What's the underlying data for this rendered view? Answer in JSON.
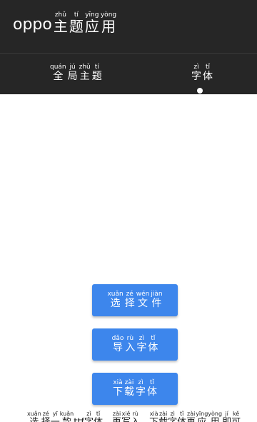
{
  "header": {
    "app_name": "oppo",
    "title": [
      {
        "char": "主",
        "pinyin": "zhǔ"
      },
      {
        "char": "题",
        "pinyin": "tí"
      },
      {
        "char": "应",
        "pinyin": "yīng"
      },
      {
        "char": "用",
        "pinyin": "yòng"
      }
    ]
  },
  "tabs": [
    {
      "id": "global-theme",
      "selected": false,
      "chars": [
        {
          "char": "全",
          "pinyin": "quán"
        },
        {
          "char": "局",
          "pinyin": "jú"
        },
        {
          "char": "主",
          "pinyin": "zhǔ"
        },
        {
          "char": "题",
          "pinyin": "tí"
        }
      ]
    },
    {
      "id": "font",
      "selected": true,
      "chars": [
        {
          "char": "字",
          "pinyin": "zì"
        },
        {
          "char": "体",
          "pinyin": "tǐ"
        }
      ]
    }
  ],
  "buttons": [
    {
      "id": "select-file",
      "chars": [
        {
          "char": "选",
          "pinyin": "xuǎn"
        },
        {
          "char": "择",
          "pinyin": "zé"
        },
        {
          "char": "文",
          "pinyin": "wén"
        },
        {
          "char": "件",
          "pinyin": "jiàn"
        }
      ]
    },
    {
      "id": "import-font",
      "chars": [
        {
          "char": "导",
          "pinyin": "dǎo"
        },
        {
          "char": "入",
          "pinyin": "rù"
        },
        {
          "char": "字",
          "pinyin": "zì"
        },
        {
          "char": "体",
          "pinyin": "tǐ"
        }
      ]
    },
    {
      "id": "download-font",
      "chars": [
        {
          "char": "下",
          "pinyin": "xià"
        },
        {
          "char": "载",
          "pinyin": "zài"
        },
        {
          "char": "字",
          "pinyin": "zì"
        },
        {
          "char": "体",
          "pinyin": "tǐ"
        }
      ]
    }
  ],
  "bottom_note": {
    "chars": [
      {
        "char": "选",
        "pinyin": "xuǎn"
      },
      {
        "char": "择",
        "pinyin": "zé"
      },
      {
        "char": "一",
        "pinyin": "yī"
      },
      {
        "char": "款",
        "pinyin": "kuǎn"
      },
      {
        "char": "ttf",
        "pinyin": ""
      },
      {
        "char": "字",
        "pinyin": "zì"
      },
      {
        "char": "体",
        "pinyin": "tǐ"
      },
      {
        "char": "，",
        "pinyin": ""
      },
      {
        "char": "再",
        "pinyin": "zài"
      },
      {
        "char": "写",
        "pinyin": "xiě"
      },
      {
        "char": "入",
        "pinyin": "rù"
      },
      {
        "char": "，",
        "pinyin": ""
      },
      {
        "char": "下",
        "pinyin": "xià"
      },
      {
        "char": "载",
        "pinyin": "zài"
      },
      {
        "char": "字",
        "pinyin": "zì"
      },
      {
        "char": "体",
        "pinyin": "tǐ"
      },
      {
        "char": "再",
        "pinyin": "zài"
      },
      {
        "char": "应",
        "pinyin": "yīng"
      },
      {
        "char": "用",
        "pinyin": "yòng"
      },
      {
        "char": "即",
        "pinyin": "jí"
      },
      {
        "char": "可",
        "pinyin": "kě"
      }
    ]
  },
  "colors": {
    "header_bg": "#262626",
    "button_bg": "#3d86ec",
    "content_bg": "#ffffff"
  }
}
